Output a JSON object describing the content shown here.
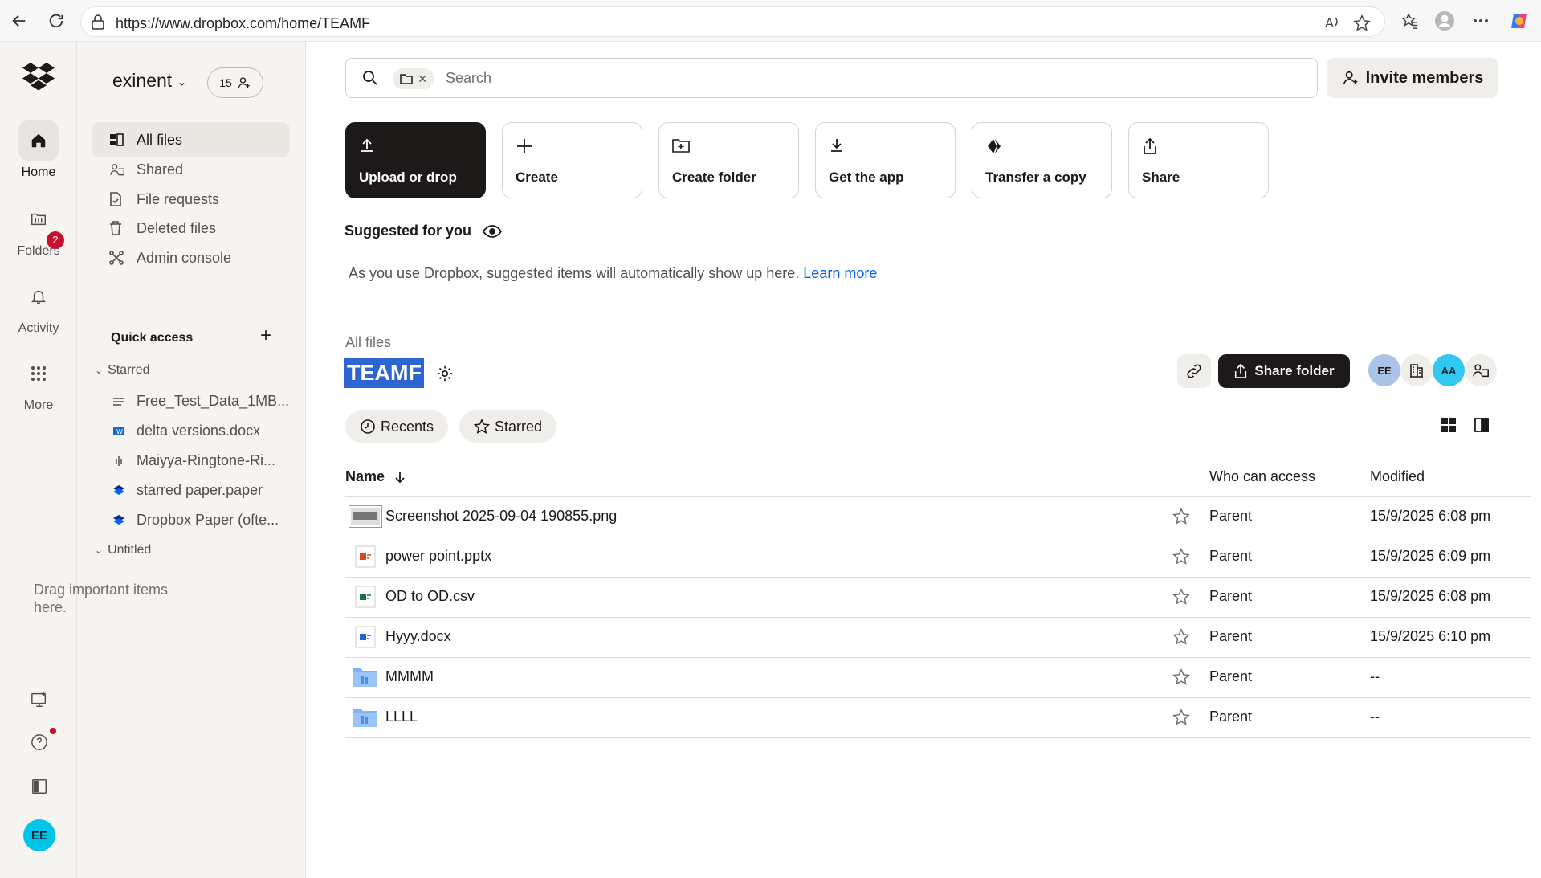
{
  "browser": {
    "url": "https://www.dropbox.com/home/TEAMF"
  },
  "rail": {
    "home": "Home",
    "folders": "Folders",
    "activity": "Activity",
    "activity_badge": "2",
    "more": "More",
    "avatar": "EE"
  },
  "sidebar": {
    "team_name": "exinent",
    "member_count": "15",
    "nav": [
      {
        "label": "All files"
      },
      {
        "label": "Shared"
      },
      {
        "label": "File requests"
      },
      {
        "label": "Deleted files"
      },
      {
        "label": "Admin console"
      }
    ],
    "quick_access": "Quick access",
    "starred_title": "Starred",
    "starred": [
      {
        "label": "Free_Test_Data_1MB..."
      },
      {
        "label": "delta versions.docx"
      },
      {
        "label": "Maiyya-Ringtone-Ri..."
      },
      {
        "label": "starred paper.paper"
      },
      {
        "label": "Dropbox Paper (ofte..."
      }
    ],
    "untitled_title": "Untitled",
    "drag_hint": "Drag important items here."
  },
  "search": {
    "placeholder": "Search"
  },
  "invite_label": "Invite members",
  "actions": [
    {
      "label": "Upload or drop"
    },
    {
      "label": "Create"
    },
    {
      "label": "Create folder"
    },
    {
      "label": "Get the app"
    },
    {
      "label": "Transfer a copy"
    },
    {
      "label": "Share"
    }
  ],
  "suggested": {
    "title": "Suggested for you",
    "text": "As you use Dropbox, suggested items will automatically show up here.",
    "link": "Learn more"
  },
  "folder": {
    "breadcrumb": "All files",
    "title": "TEAMF",
    "share_label": "Share folder",
    "access": [
      {
        "initials": "EE",
        "color": "#a9c4e8"
      },
      {
        "initials": "AA",
        "color": "#32c8f0"
      }
    ]
  },
  "filters": {
    "recents": "Recents",
    "starred": "Starred"
  },
  "table": {
    "col_name": "Name",
    "col_who": "Who can access",
    "col_modified": "Modified",
    "rows": [
      {
        "name": "Screenshot 2025-09-04 190855.png",
        "who": "Parent",
        "modified": "15/9/2025 6:08 pm",
        "icon": "image-thumbnail-icon"
      },
      {
        "name": "power point.pptx",
        "who": "Parent",
        "modified": "15/9/2025 6:09 pm",
        "icon": "pptx-file-icon"
      },
      {
        "name": "OD to OD.csv",
        "who": "Parent",
        "modified": "15/9/2025 6:08 pm",
        "icon": "csv-file-icon"
      },
      {
        "name": "Hyyy.docx",
        "who": "Parent",
        "modified": "15/9/2025 6:10 pm",
        "icon": "docx-file-icon"
      },
      {
        "name": "MMMM",
        "who": "Parent",
        "modified": "--",
        "icon": "team-folder-icon"
      },
      {
        "name": "LLLL",
        "who": "Parent",
        "modified": "--",
        "icon": "team-folder-icon"
      }
    ]
  },
  "colors": {
    "accent": "#0061fe",
    "selected_title_bg": "#2d65d2",
    "dark_button": "#1e1919",
    "badge": "#c8102e"
  }
}
